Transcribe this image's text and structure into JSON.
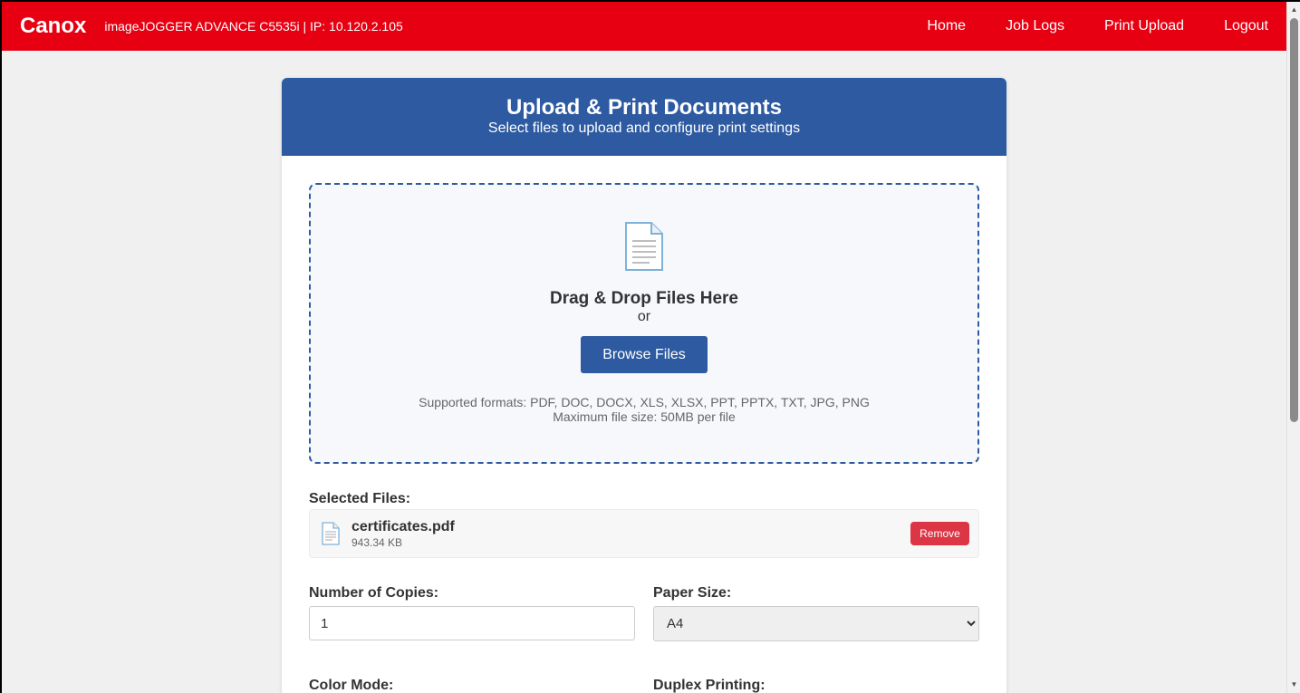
{
  "navbar": {
    "brand": "Canox",
    "device_info": "imageJOGGER ADVANCE C5535i | IP: 10.120.2.105",
    "links": [
      "Home",
      "Job Logs",
      "Print Upload",
      "Logout"
    ]
  },
  "header": {
    "title": "Upload & Print Documents",
    "subtitle": "Select files to upload and configure print settings"
  },
  "dropzone": {
    "title": "Drag & Drop Files Here",
    "or": "or",
    "browse_label": "Browse Files",
    "formats": "Supported formats: PDF, DOC, DOCX, XLS, XLSX, PPT, PPTX, TXT, JPG, PNG",
    "max_size": "Maximum file size: 50MB per file"
  },
  "selected_files": {
    "label": "Selected Files:",
    "files": [
      {
        "name": "certificates.pdf",
        "size": "943.34 KB",
        "remove_label": "Remove"
      }
    ]
  },
  "settings": {
    "copies_label": "Number of Copies:",
    "copies_value": "1",
    "paper_label": "Paper Size:",
    "paper_value": "A4",
    "color_label": "Color Mode:",
    "duplex_label": "Duplex Printing:"
  },
  "colors": {
    "navbar": "#e60012",
    "card_header": "#2d5aa0",
    "remove_button": "#dc3545"
  },
  "icons": [
    "document-icon",
    "file-icon"
  ]
}
